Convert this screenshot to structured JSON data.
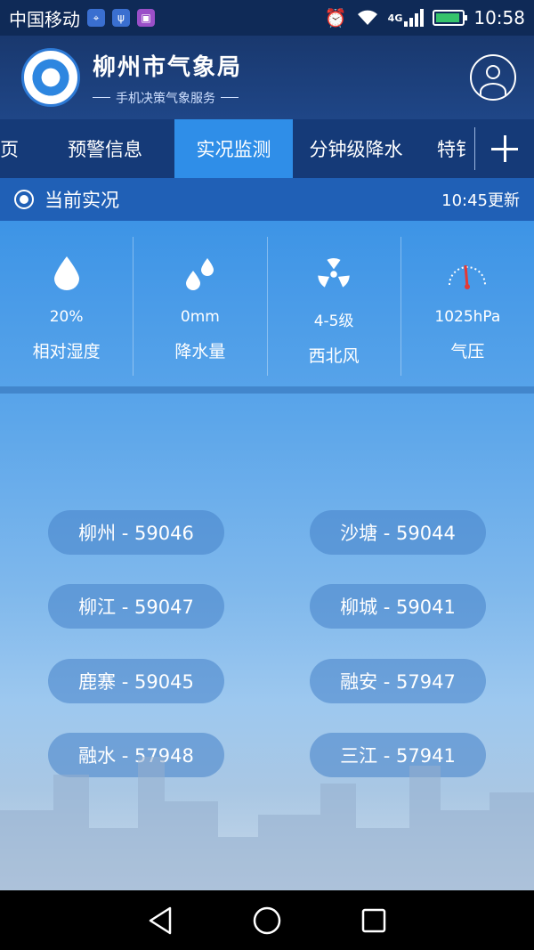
{
  "status_bar": {
    "carrier": "中国移动",
    "network": "4G",
    "time": "10:58",
    "battery_percent": 90,
    "battery_color": "#35c36b"
  },
  "header": {
    "title": "柳州市气象局",
    "subtitle": "手机决策气象服务"
  },
  "tabs": [
    {
      "label": "页",
      "active": false
    },
    {
      "label": "预警信息",
      "active": false
    },
    {
      "label": "实况监测",
      "active": true
    },
    {
      "label": "分钟级降水",
      "active": false
    },
    {
      "label": "特钅",
      "active": false
    }
  ],
  "section": {
    "title": "当前实况",
    "update_time": "10:45更新"
  },
  "metrics": [
    {
      "icon": "droplet-icon",
      "value": "20%",
      "label": "相对湿度"
    },
    {
      "icon": "raindrops-icon",
      "value": "0mm",
      "label": "降水量"
    },
    {
      "icon": "fan-icon",
      "value": "4-5级",
      "label": "西北风"
    },
    {
      "icon": "gauge-icon",
      "value": "1025hPa",
      "label": "气压"
    }
  ],
  "stations": [
    "柳州 - 59046",
    "沙塘 - 59044",
    "柳江 - 59047",
    "柳城 - 59041",
    "鹿寨 - 59045",
    "融安 - 57947",
    "融水 - 57948",
    "三江 - 57941"
  ],
  "colors": {
    "header_bg": "#19386e",
    "tab_bg": "#153a78",
    "tab_active": "#2f8ee8",
    "section_bg": "#2060b6"
  }
}
